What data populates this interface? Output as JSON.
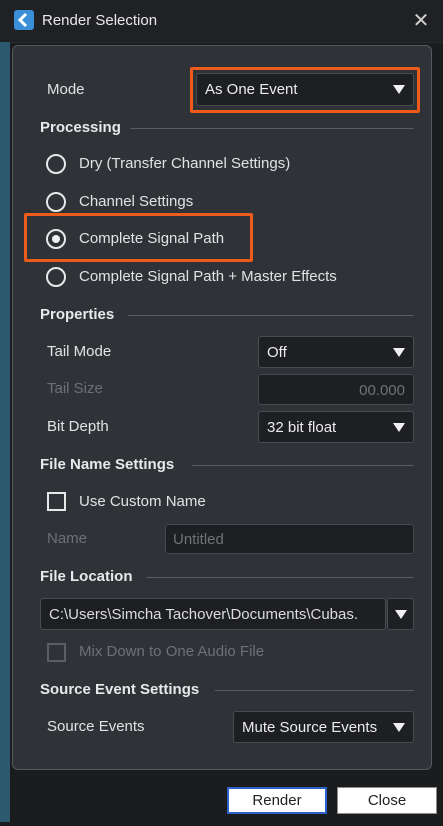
{
  "window": {
    "title": "Render Selection"
  },
  "mode": {
    "label": "Mode",
    "value": "As One Event"
  },
  "processing": {
    "heading": "Processing",
    "options": [
      {
        "label": "Dry (Transfer Channel Settings)",
        "selected": false
      },
      {
        "label": "Channel Settings",
        "selected": false
      },
      {
        "label": "Complete Signal Path",
        "selected": true
      },
      {
        "label": "Complete Signal Path + Master Effects",
        "selected": false
      }
    ]
  },
  "properties": {
    "heading": "Properties",
    "tail_mode": {
      "label": "Tail Mode",
      "value": "Off"
    },
    "tail_size": {
      "label": "Tail Size",
      "value": "00.000"
    },
    "bit_depth": {
      "label": "Bit Depth",
      "value": "32 bit float"
    }
  },
  "file_name": {
    "heading": "File Name Settings",
    "use_custom": {
      "label": "Use Custom Name",
      "checked": false
    },
    "name": {
      "label": "Name",
      "placeholder": "Untitled"
    }
  },
  "file_location": {
    "heading": "File Location",
    "path": "C:\\Users\\Simcha Tachover\\Documents\\Cubas.",
    "mixdown": {
      "label": "Mix Down to One Audio File",
      "checked": false
    }
  },
  "source": {
    "heading": "Source Event Settings",
    "events": {
      "label": "Source Events",
      "value": "Mute Source Events"
    }
  },
  "buttons": {
    "render": "Render",
    "close": "Close"
  },
  "colors": {
    "highlight": "#ef5b1a",
    "panel": "#2f3338",
    "primary_border": "#2a62c9"
  }
}
